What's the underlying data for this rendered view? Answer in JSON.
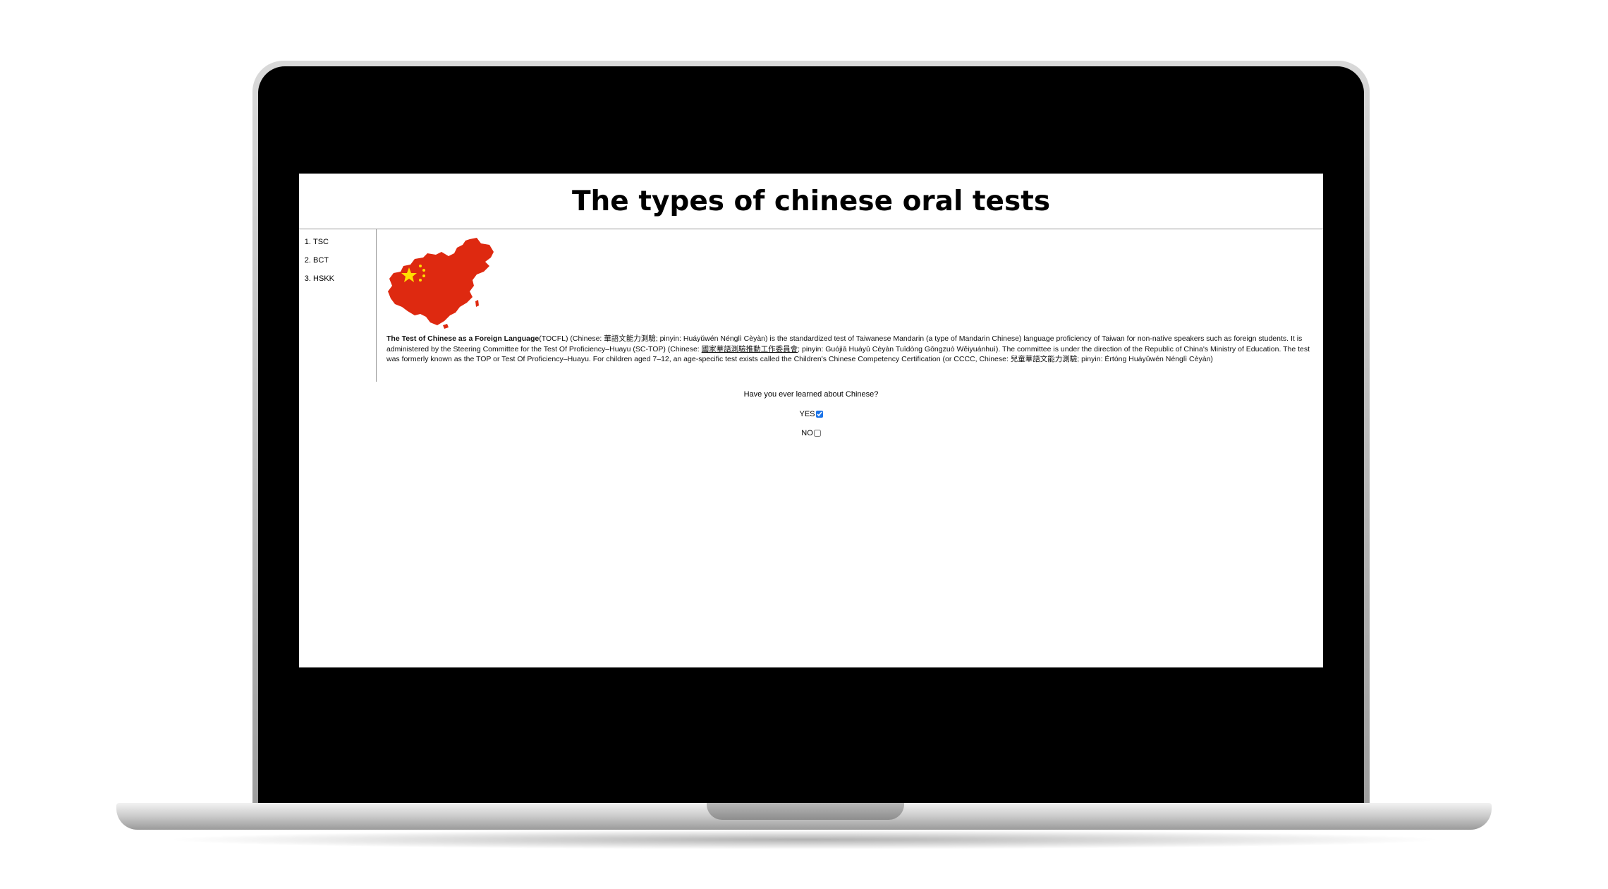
{
  "page": {
    "title": "The types of chinese oral tests"
  },
  "sidebar": {
    "items": [
      {
        "label": "TSC"
      },
      {
        "label": "BCT"
      },
      {
        "label": "HSKK"
      }
    ]
  },
  "article": {
    "bold_lead": "The Test of Chinese as a Foreign Language",
    "part1": "(TOCFL) (Chinese: 華語文能力測驗; pinyin: Huáyǔwén Nénglì Cèyàn) is the standardized test of Taiwanese Mandarin (a type of Mandarin Chinese) language proficiency of Taiwan for non-native speakers such as foreign students. It is administered by the Steering Committee for the Test Of Proficiency–Huayu (SC-TOP) (Chinese: ",
    "underlined": "國家華語測驗推動工作委員會",
    "part2": "; pinyin: Guójiā Huáyǔ Cèyàn Tuīdòng Gōngzuò Wěiyuánhuì). The committee is under the direction of the Republic of China's Ministry of Education. The test was formerly known as the TOP or Test Of Proficiency–Huayu. For children aged 7–12, an age-specific test exists called the Children's Chinese Competency Certification (or CCCC, Chinese: 兒童華語文能力測驗; pinyin: Értóng Huáyǔwén Nénglì Cèyàn)"
  },
  "map": {
    "icon": "china-flag-map-icon",
    "fill_color": "#de2910",
    "star_color": "#ffde00"
  },
  "survey": {
    "question": "Have you ever learned about Chinese?",
    "options": [
      {
        "label": "YES",
        "checked": true
      },
      {
        "label": "NO",
        "checked": false
      }
    ]
  },
  "frame": {
    "bezel_color": "#000000",
    "body_color": "#c8c8c8"
  }
}
